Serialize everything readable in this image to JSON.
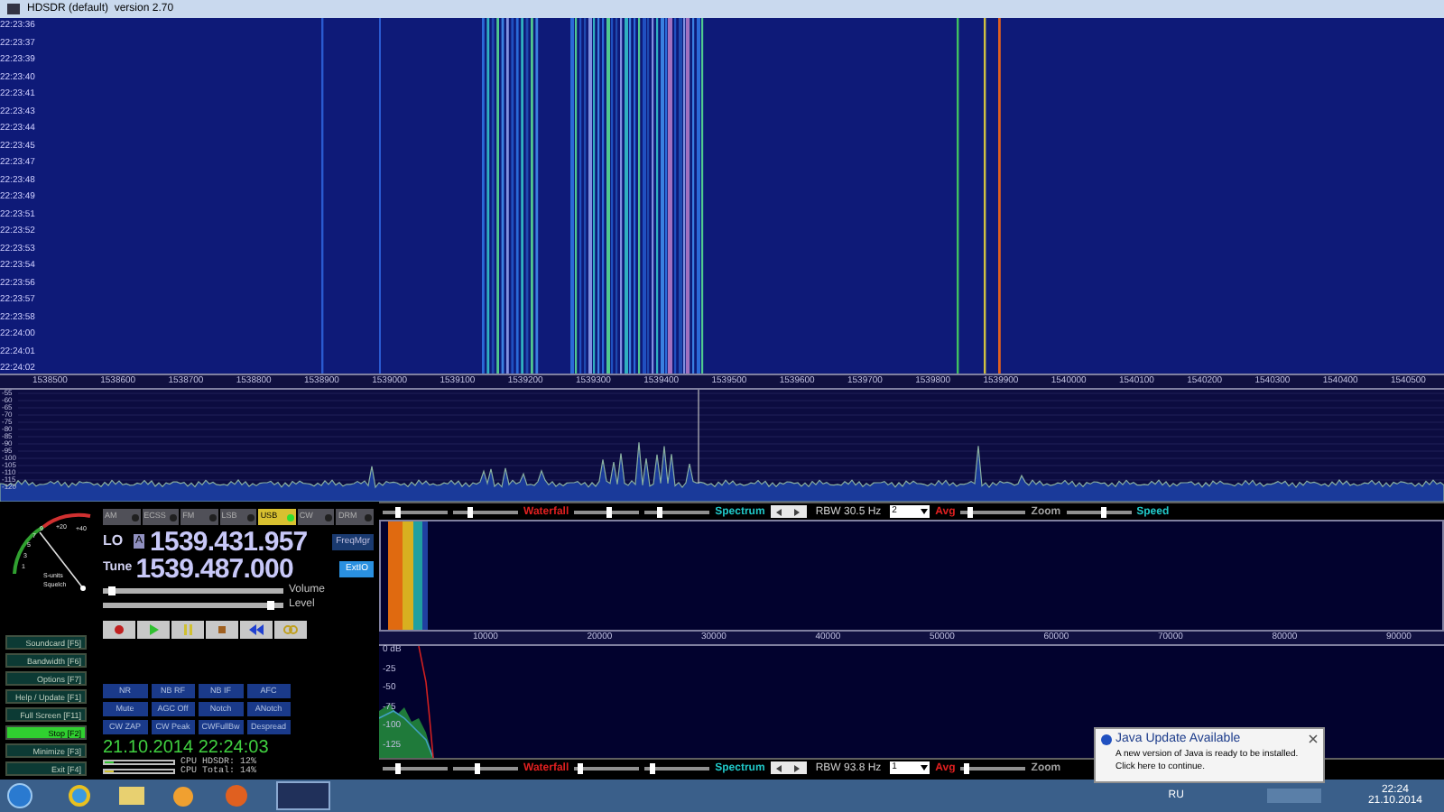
{
  "window": {
    "title": "HDSDR (default)  version 2.70"
  },
  "waterfall": {
    "timestamps": [
      "22:23:36",
      "22:23:37",
      "22:23:39",
      "22:23:40",
      "22:23:41",
      "22:23:43",
      "22:23:44",
      "22:23:45",
      "22:23:47",
      "22:23:48",
      "22:23:49",
      "22:23:51",
      "22:23:52",
      "22:23:53",
      "22:23:54",
      "22:23:56",
      "22:23:57",
      "22:23:58",
      "22:24:00",
      "22:24:01",
      "22:24:02"
    ]
  },
  "frequency_axis": {
    "labels": [
      "1538500",
      "1538600",
      "1538700",
      "1538800",
      "1538900",
      "1539000",
      "1539100",
      "1539200",
      "1539300",
      "1539400",
      "1539500",
      "1539600",
      "1539700",
      "1539800",
      "1539900",
      "1540000",
      "1540100",
      "1540200",
      "1540300",
      "1540400",
      "1540500"
    ]
  },
  "spectrum": {
    "y_labels": [
      "-55",
      "-60",
      "-65",
      "-70",
      "-75",
      "-80",
      "-85",
      "-90",
      "-95",
      "-100",
      "-105",
      "-110",
      "-115",
      "-120"
    ]
  },
  "smeter": {
    "scale": [
      "1",
      "3",
      "5",
      "7",
      "9",
      "+20",
      "+40"
    ],
    "caption": "S-units",
    "squelch_label": "Squelch"
  },
  "modes": [
    {
      "label": "AM",
      "selected": false
    },
    {
      "label": "ECSS",
      "selected": false
    },
    {
      "label": "FM",
      "selected": false
    },
    {
      "label": "LSB",
      "selected": false
    },
    {
      "label": "USB",
      "selected": true
    },
    {
      "label": "CW",
      "selected": false
    },
    {
      "label": "DRM",
      "selected": false
    }
  ],
  "lo": {
    "label": "LO",
    "vfo": "A",
    "value": "1539.431.957"
  },
  "tune": {
    "label": "Tune",
    "value": "1539.487.000"
  },
  "side_buttons": [
    {
      "label": "FreqMgr",
      "on": false
    },
    {
      "label": "ExtIO",
      "on": true
    }
  ],
  "sliders": [
    {
      "label": "Volume",
      "level": 0.03
    },
    {
      "label": "Level",
      "level": 0.95
    }
  ],
  "transport": [
    {
      "kind": "record"
    },
    {
      "kind": "play"
    },
    {
      "kind": "pause"
    },
    {
      "kind": "stop"
    },
    {
      "kind": "rewind"
    },
    {
      "kind": "loop"
    }
  ],
  "function_keys": [
    {
      "label": "Soundcard [F5]",
      "on": false
    },
    {
      "label": "Bandwidth [F6]",
      "on": false
    },
    {
      "label": "Options [F7]",
      "on": false
    },
    {
      "label": "Help / Update [F1]",
      "on": false
    },
    {
      "label": "Full Screen [F11]",
      "on": false
    },
    {
      "label": "Stop [F2]",
      "on": true
    },
    {
      "label": "Minimize [F3]",
      "on": false
    },
    {
      "label": "Exit [F4]",
      "on": false
    }
  ],
  "dsp_buttons": [
    "NR",
    "NB RF",
    "NB IF",
    "AFC",
    "Mute",
    "AGC Off",
    "Notch",
    "ANotch",
    "CW ZAP",
    "CW Peak",
    "CWFullBw",
    "Despread"
  ],
  "clock": "21.10.2014 22:24:03",
  "cpu": [
    {
      "label": "CPU HDSDR: 12%",
      "level": 0.12
    },
    {
      "label": "CPU Total: 14%",
      "level": 0.14
    }
  ],
  "rf_toolbar": [
    {
      "kind": "slider",
      "level": 0.2
    },
    {
      "kind": "slider",
      "level": 0.25
    },
    {
      "kind": "label",
      "text": "Waterfall",
      "color": "#e02020"
    },
    {
      "kind": "slider",
      "level": 0.55
    },
    {
      "kind": "slider",
      "level": 0.2
    },
    {
      "kind": "label",
      "text": "Spectrum",
      "color": "#20c8c8"
    },
    {
      "kind": "stepper"
    },
    {
      "kind": "text",
      "text": "RBW 30.5 Hz"
    },
    {
      "kind": "select",
      "value": "2"
    },
    {
      "kind": "label",
      "text": "Avg",
      "color": "#e02020"
    },
    {
      "kind": "slider",
      "level": 0.1
    },
    {
      "kind": "label",
      "text": "Zoom",
      "color": "#a0a0a0"
    },
    {
      "kind": "slider",
      "level": 0.6
    },
    {
      "kind": "label",
      "text": "Speed",
      "color": "#20c8c8"
    }
  ],
  "af_axis": {
    "labels": [
      "10000",
      "20000",
      "30000",
      "40000",
      "50000",
      "60000",
      "70000",
      "80000",
      "90000"
    ]
  },
  "af_spectrum": {
    "y_labels": [
      "0 dB",
      "-25",
      "-50",
      "-75",
      "-100",
      "-125"
    ]
  },
  "af_toolbar": [
    {
      "kind": "slider",
      "level": 0.2
    },
    {
      "kind": "slider",
      "level": 0.35
    },
    {
      "kind": "label",
      "text": "Waterfall",
      "color": "#e02020"
    },
    {
      "kind": "slider",
      "level": 0.05
    },
    {
      "kind": "slider",
      "level": 0.1
    },
    {
      "kind": "label",
      "text": "Spectrum",
      "color": "#20c8c8"
    },
    {
      "kind": "stepper"
    },
    {
      "kind": "text",
      "text": "RBW 93.8 Hz"
    },
    {
      "kind": "select",
      "value": "1"
    },
    {
      "kind": "label",
      "text": "Avg",
      "color": "#e02020"
    },
    {
      "kind": "slider",
      "level": 0.05
    },
    {
      "kind": "label",
      "text": "Zoom",
      "color": "#a0a0a0"
    }
  ],
  "taskbar": {
    "keyboard_layout": "RU",
    "time": "22:24",
    "date": "21.10.2014"
  },
  "notification": {
    "title": "Java Update Available",
    "message": "A new version of Java is ready to be installed.",
    "link": "Click here to continue."
  }
}
